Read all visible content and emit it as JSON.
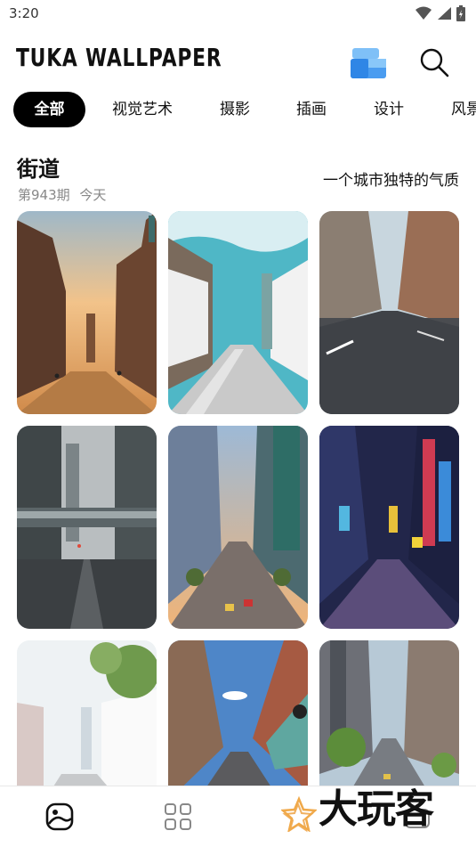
{
  "status_bar": {
    "time": "3:20",
    "icons": [
      "wifi-icon",
      "signal-icon",
      "battery-icon"
    ]
  },
  "header": {
    "logo": "TUKA WALLPAPER",
    "cube_icon": "cube-stack-icon",
    "search_icon": "search-icon"
  },
  "tabs": [
    {
      "label": "全部",
      "active": true
    },
    {
      "label": "视觉艺术",
      "active": false
    },
    {
      "label": "摄影",
      "active": false
    },
    {
      "label": "插画",
      "active": false
    },
    {
      "label": "设计",
      "active": false
    },
    {
      "label": "风景",
      "active": false
    }
  ],
  "section": {
    "title": "街道",
    "issue": "第943期",
    "date": "今天",
    "slogan": "一个城市独特的气质"
  },
  "wallpapers": [
    {
      "subject": "old-town-street-sunset"
    },
    {
      "subject": "white-house-street-teal-sky"
    },
    {
      "subject": "empty-street-between-buildings"
    },
    {
      "subject": "rainy-city-skybridge"
    },
    {
      "subject": "downtown-avenue-skyscrapers"
    },
    {
      "subject": "neon-night-street"
    },
    {
      "subject": "bright-alley-tree"
    },
    {
      "subject": "brick-street-blue-sky"
    },
    {
      "subject": "hillside-city-street"
    }
  ],
  "bottom_nav": [
    {
      "name": "wallpaper-icon",
      "active": true
    },
    {
      "name": "categories-icon",
      "active": false
    },
    {
      "name": "favorites-icon",
      "active": false
    },
    {
      "name": "profile-icon",
      "active": false
    }
  ],
  "watermark": "大玩客",
  "colors": {
    "accent": "#000000",
    "muted_text": "#888888",
    "cube_blue": "#4a9cf0"
  }
}
